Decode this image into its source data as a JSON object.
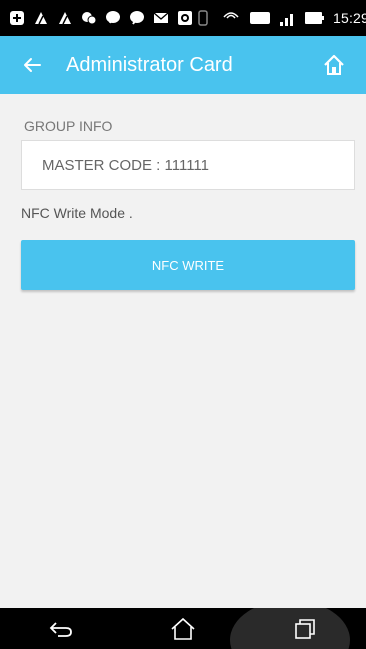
{
  "status_bar": {
    "time": "15:29",
    "network_label": "4G",
    "nfc_label": "NFC"
  },
  "app_bar": {
    "title": "Administrator Card",
    "color": "#49c3ee"
  },
  "content": {
    "group_label": "GROUP INFO",
    "master_code_text": "MASTER CODE : 111111",
    "mode_text": "NFC  Write Mode .",
    "nfc_write_button": "NFC WRITE"
  },
  "icons": {
    "back": "arrow-left-icon",
    "home": "home-icon",
    "nav_back": "back-icon",
    "nav_home": "home-outline-icon",
    "nav_recents": "recent-apps-icon"
  }
}
